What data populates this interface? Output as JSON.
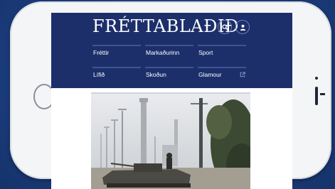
{
  "site": {
    "logo_text": "FRÉTTABLAÐIÐ",
    "brand_color": "#1c2f6b",
    "nav_items": [
      {
        "label": "Fréttir"
      },
      {
        "label": "Markaðurinn"
      },
      {
        "label": "Sport"
      },
      {
        "label": "Lífið"
      },
      {
        "label": "Skoðun"
      },
      {
        "label": "Glamour",
        "icon": "external-link-icon"
      }
    ],
    "header_icons": [
      "search-icon",
      "user-icon"
    ]
  },
  "article": {
    "image": "photo-of-armored-vehicle-and-street-lamps"
  }
}
